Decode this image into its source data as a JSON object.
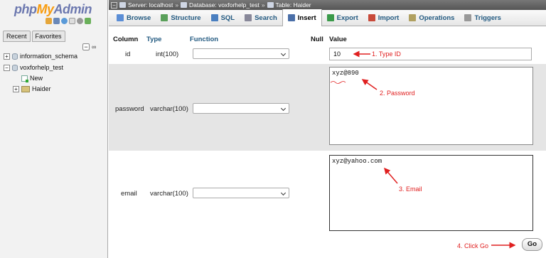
{
  "sidebar": {
    "logo_php": "php",
    "logo_my": "My",
    "logo_admin": "Admin",
    "tabs": [
      "Recent",
      "Favorites"
    ],
    "collapse_label": "−",
    "link_label": "∞",
    "tree": [
      {
        "label": "information_schema",
        "expander": "+"
      },
      {
        "label": "voxforhelp_test",
        "expander": "−"
      },
      {
        "label": "New"
      },
      {
        "label": "Haider",
        "expander": "+"
      }
    ]
  },
  "breadcrumb": {
    "collapse": "−",
    "server": "Server: localhost",
    "sep": "»",
    "database": "Database: voxforhelp_test",
    "table": "Table: Haider"
  },
  "tabs": [
    {
      "label": "Browse",
      "icon": "browse-icon",
      "color": "#5b8ed6"
    },
    {
      "label": "Structure",
      "icon": "structure-icon",
      "color": "#5aa05a"
    },
    {
      "label": "SQL",
      "icon": "sql-icon",
      "color": "#4a7fc0"
    },
    {
      "label": "Search",
      "icon": "search-icon",
      "color": "#889"
    },
    {
      "label": "Insert",
      "icon": "insert-icon",
      "color": "#4a6fa8"
    },
    {
      "label": "Export",
      "icon": "export-icon",
      "color": "#3a9a4a"
    },
    {
      "label": "Import",
      "icon": "import-icon",
      "color": "#c84a3a"
    },
    {
      "label": "Operations",
      "icon": "wrench-icon",
      "color": "#b0a060"
    },
    {
      "label": "Triggers",
      "icon": "triggers-icon",
      "color": "#999"
    }
  ],
  "active_tab": "Insert",
  "headers": {
    "column": "Column",
    "type": "Type",
    "function": "Function",
    "null": "Null",
    "value": "Value"
  },
  "rows": [
    {
      "column": "id",
      "type": "int(100)",
      "function": "",
      "value": "10"
    },
    {
      "column": "password",
      "type": "varchar(100)",
      "function": "",
      "value": "xyz@890"
    },
    {
      "column": "email",
      "type": "varchar(100)",
      "function": "",
      "value": "xyz@yahoo.com"
    }
  ],
  "annotations": [
    "1. Type ID",
    "2. Password",
    "3. Email",
    "4. Click Go"
  ],
  "go_label": "Go",
  "colors": {
    "annotation": "#e02020",
    "link": "#235a81",
    "row_alt": "#e5e5e5"
  }
}
